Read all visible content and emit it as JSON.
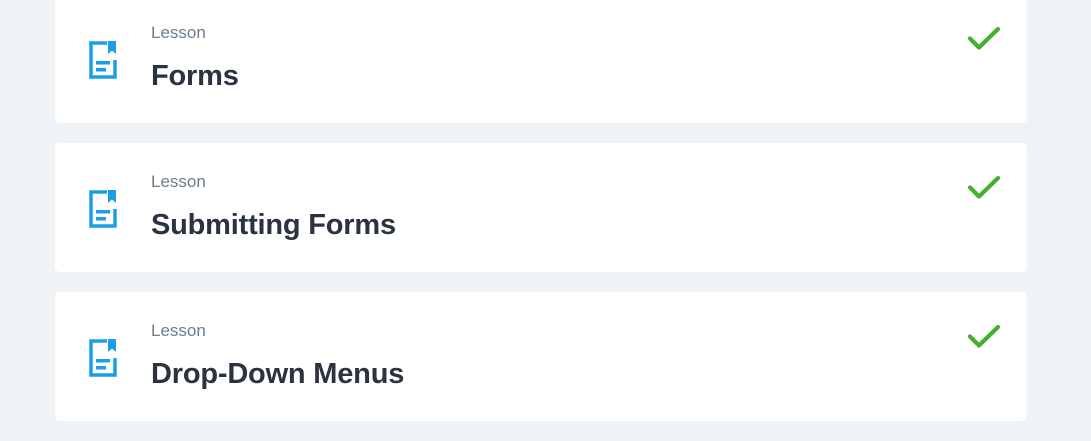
{
  "colors": {
    "page_background": "#f0f3f6",
    "card_background": "#ffffff",
    "lesson_icon": "#1a9ee6",
    "check_icon": "#45b02d",
    "kind_text": "#6b7d8e",
    "title_text": "#2b3340"
  },
  "lessons": [
    {
      "kind": "Lesson",
      "title": "Forms",
      "icon": "lesson-document-icon",
      "status_icon": "checkmark-icon",
      "completed": true
    },
    {
      "kind": "Lesson",
      "title": "Submitting Forms",
      "icon": "lesson-document-icon",
      "status_icon": "checkmark-icon",
      "completed": true
    },
    {
      "kind": "Lesson",
      "title": "Drop-Down Menus",
      "icon": "lesson-document-icon",
      "status_icon": "checkmark-icon",
      "completed": true
    }
  ]
}
